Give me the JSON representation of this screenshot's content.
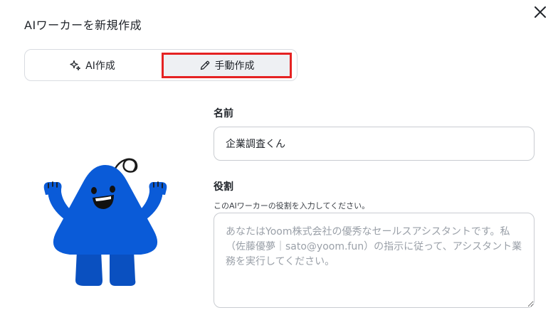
{
  "dialog": {
    "title": "AIワーカーを新規作成"
  },
  "mode_toggle": {
    "ai_label": "AI作成",
    "manual_label": "手動作成",
    "selected": "manual"
  },
  "form": {
    "name_label": "名前",
    "name_value": "企業調査くん",
    "role_label": "役割",
    "role_hint": "このAIワーカーの役割を入力してください。",
    "role_placeholder": "あなたはYoom株式会社の優秀なセールスアシスタントです。私（佐藤優夢｜sato@yoom.fun）の指示に従って、アシスタント業務を実行してください。"
  },
  "colors": {
    "mascot_blue": "#0a5bd8",
    "highlight_red": "#e52222"
  },
  "icons": [
    "close-icon",
    "sparkle-icon",
    "pencil-icon"
  ]
}
